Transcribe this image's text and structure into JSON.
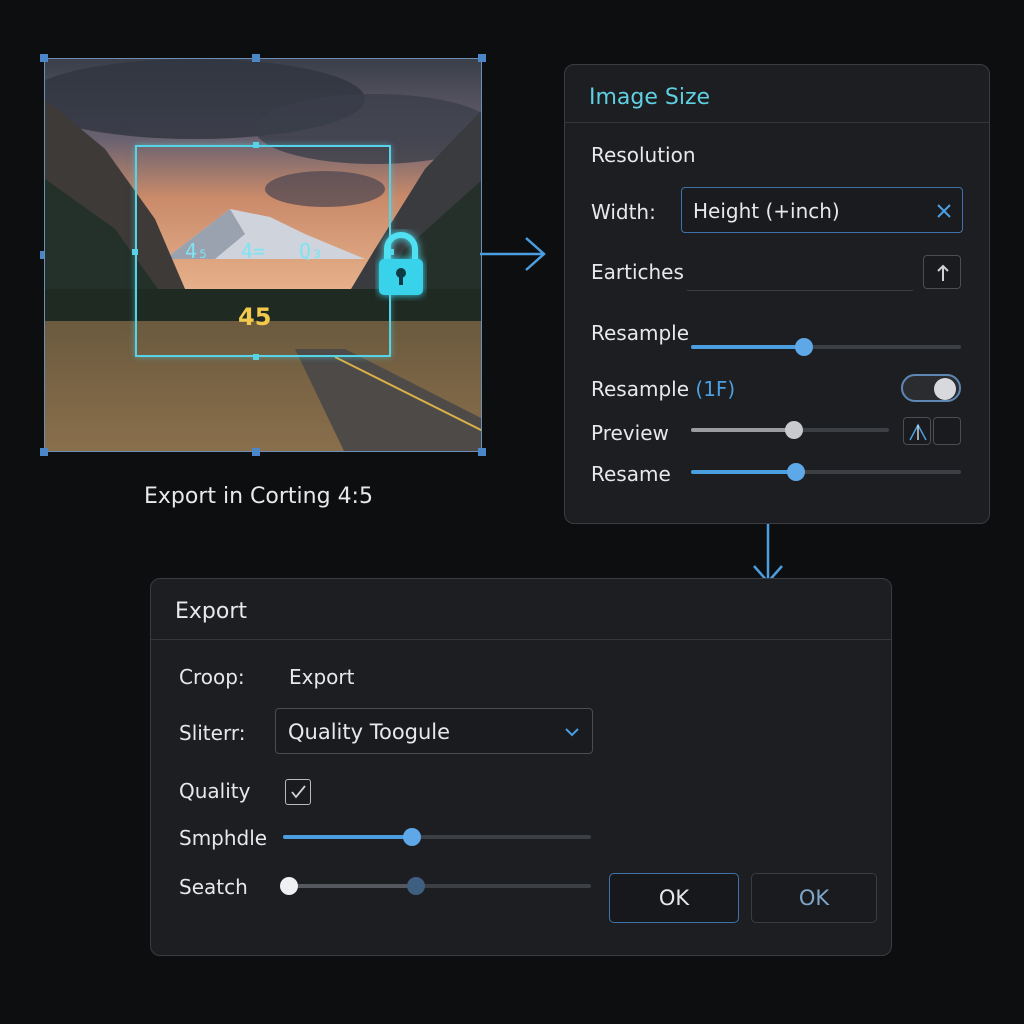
{
  "preview": {
    "ratio_labels": [
      "4₅",
      "4=",
      "Q₃"
    ],
    "ratio_main": "45",
    "caption": "Export in Corting 4:5",
    "crop_color": "#57d3e8",
    "lock_icon": "lock-icon"
  },
  "image_size": {
    "title": "Image Size",
    "title_color": "#5fcfe2",
    "section": "Resolution",
    "width_label": "Width:",
    "width_value": "Height (+inch)",
    "batches_label": "Eartiches",
    "resample_label": "Resample",
    "resample_value": 0.42,
    "resample_toggle_label": "Resample",
    "resample_toggle_unit": "(1F)",
    "resample_toggle_on": true,
    "preview_label": "Preview",
    "preview_value": 0.52,
    "resame_label": "Resame",
    "resame_value": 0.39
  },
  "export": {
    "title": "Export",
    "croop_label": "Croop:",
    "croop_value": "Export",
    "sliterr_label": "Sliterr:",
    "sliterr_value": "Quality Toogule",
    "quality_label": "Quality",
    "quality_checked": true,
    "smphdle_label": "Smphdle",
    "smphdle_value": 0.42,
    "seatch_label": "Seatch",
    "seatch_value": 0.42,
    "ok_primary": "OK",
    "ok_secondary": "OK"
  }
}
